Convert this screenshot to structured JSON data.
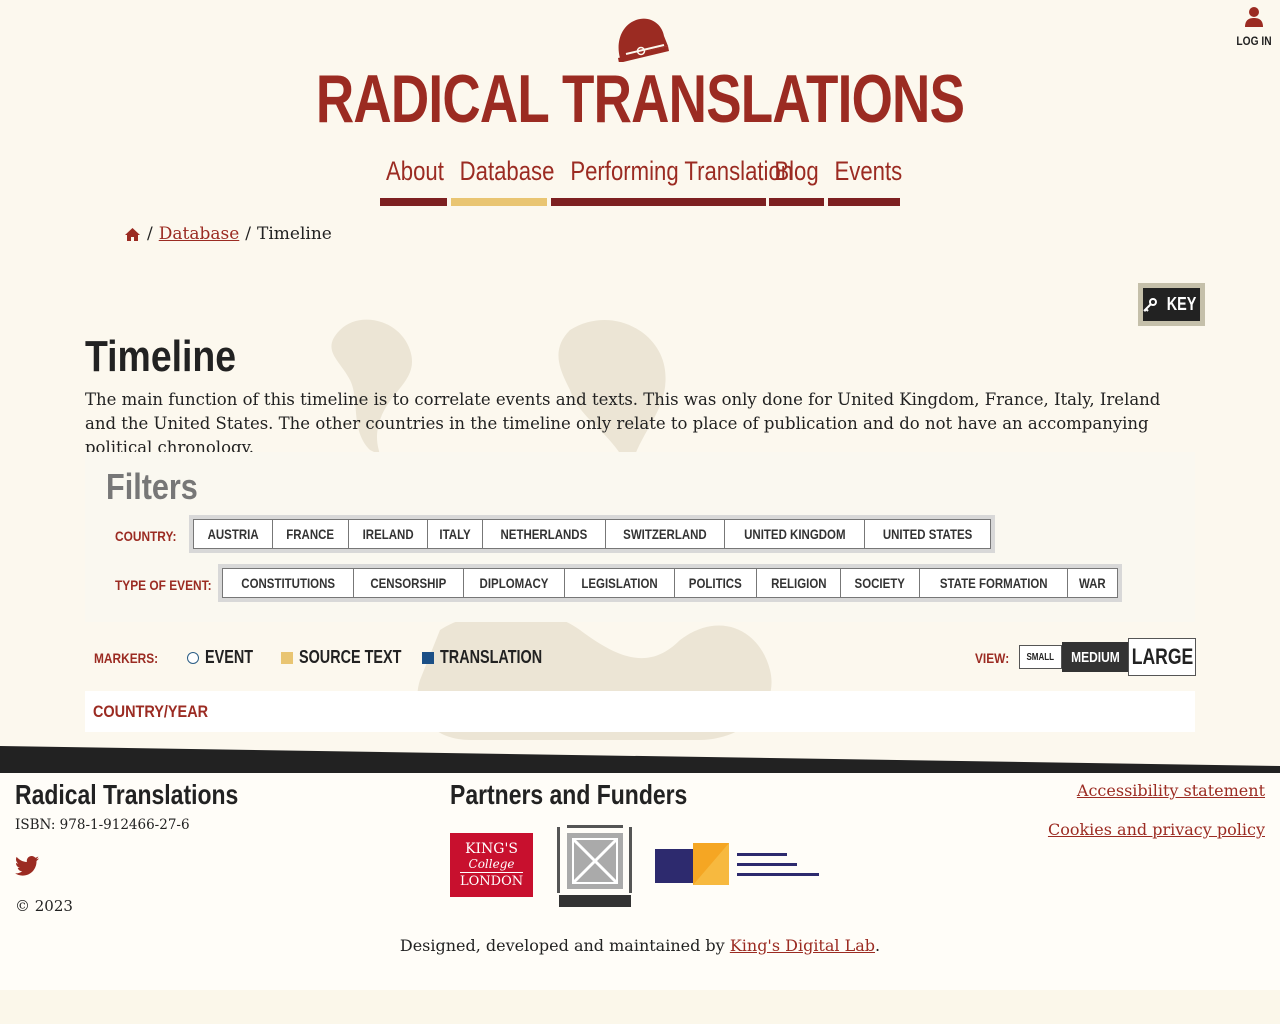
{
  "header": {
    "site_title": "RADICAL TRANSLATIONS",
    "login_label": "LOG IN"
  },
  "nav": {
    "items": [
      {
        "label": "About"
      },
      {
        "label": "Database"
      },
      {
        "label": "Performing Translation"
      },
      {
        "label": "Blog"
      },
      {
        "label": "Events"
      }
    ],
    "active": "Database"
  },
  "breadcrumb": {
    "sep1": "/",
    "link": "Database",
    "sep2": "/",
    "current": "Timeline"
  },
  "key_button": {
    "label": "KEY"
  },
  "page": {
    "title": "Timeline",
    "intro": "The main function of this timeline is to correlate events and texts. This was only done for United Kingdom, France, Italy, Ireland and the United States. The other countries in the timeline only relate to place of publication and do not have an accompanying political chronology."
  },
  "filters": {
    "heading": "Filters",
    "country_label": "COUNTRY:",
    "countries": [
      "AUSTRIA",
      "FRANCE",
      "IRELAND",
      "ITALY",
      "NETHERLANDS",
      "SWITZERLAND",
      "UNITED KINGDOM",
      "UNITED STATES"
    ],
    "event_type_label": "TYPE OF EVENT:",
    "event_types": [
      "CONSTITUTIONS",
      "CENSORSHIP",
      "DIPLOMACY",
      "LEGISLATION",
      "POLITICS",
      "RELIGION",
      "SOCIETY",
      "STATE FORMATION",
      "WAR"
    ]
  },
  "markers": {
    "label": "MARKERS:",
    "event": "EVENT",
    "source_text": "SOURCE TEXT",
    "translation": "TRANSLATION"
  },
  "view": {
    "label": "VIEW:",
    "small": "SMALL",
    "medium": "MEDIUM",
    "large": "LARGE",
    "selected": "MEDIUM"
  },
  "timeline": {
    "column_header": "COUNTRY/YEAR"
  },
  "footer": {
    "title": "Radical Translations",
    "isbn": "ISBN: 978-1-912466-27-6",
    "copyright": "© 2023",
    "partners_heading": "Partners and Funders",
    "kcl": {
      "l1": "KING'S",
      "l2": "College",
      "l3": "LONDON"
    },
    "links": [
      "Accessibility statement",
      "Cookies and privacy policy"
    ],
    "credit_prefix": "Designed, developed and maintained by",
    "credit_link": "King's Digital Lab",
    "credit_suffix": "."
  },
  "colors": {
    "brand_red": "#9b2b22",
    "nav_bar": "#7d2020",
    "nav_active": "#e9c572",
    "background": "#fcf8ee",
    "translation_marker": "#1b4f86"
  }
}
